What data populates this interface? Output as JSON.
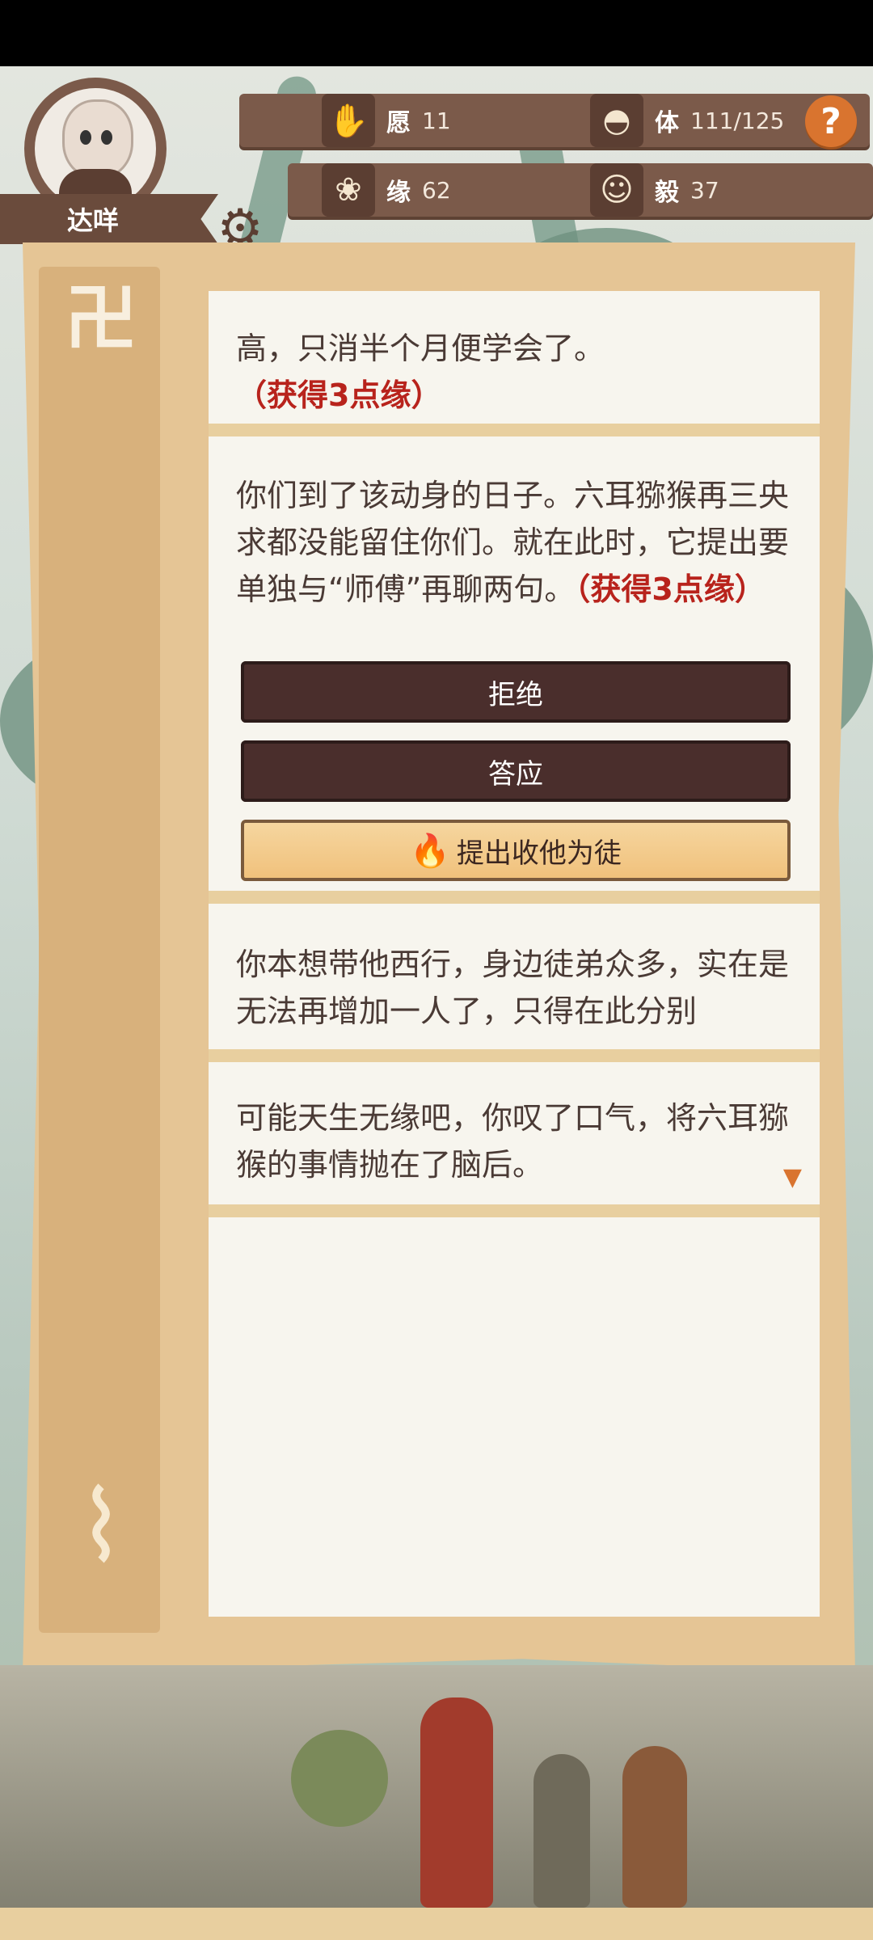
{
  "player": {
    "name": "达咩"
  },
  "stats": {
    "wish": {
      "label": "愿",
      "value": "11"
    },
    "body": {
      "label": "体",
      "value": "111/125"
    },
    "fate": {
      "label": "缘",
      "value": "62"
    },
    "resolve": {
      "label": "毅",
      "value": "37"
    }
  },
  "help_label": "?",
  "story": {
    "card1": {
      "text": "高，只消半个月便学会了。",
      "reward": "（获得3点缘）"
    },
    "card2": {
      "text": "你们到了该动身的日子。六耳猕猴再三央求都没能留住你们。就在此时，它提出要单独与“师傅”再聊两句。",
      "reward": "（获得3点缘）"
    },
    "choices": {
      "refuse": "拒绝",
      "agree": "答应",
      "disciple": "提出收他为徒"
    },
    "card3": {
      "text": "你本想带他西行，身边徒弟众多，实在是无法再增加一人了，只得在此分别"
    },
    "card4": {
      "text": "可能天生无缘吧，你叹了口气，将六耳猕猴的事情抛在了脑后。"
    }
  },
  "icons": {
    "wish": "hand-icon",
    "body": "bun-icon",
    "fate": "lotus-icon",
    "resolve": "buddha-icon",
    "settings": "gear-icon",
    "disciple": "fire-icon",
    "more": "chevron-down-icon"
  },
  "colors": {
    "reward": "#b8231c",
    "button_dark": "#4a2e2c",
    "button_gold": "#f0c07a",
    "hud": "#7b5a4a"
  }
}
